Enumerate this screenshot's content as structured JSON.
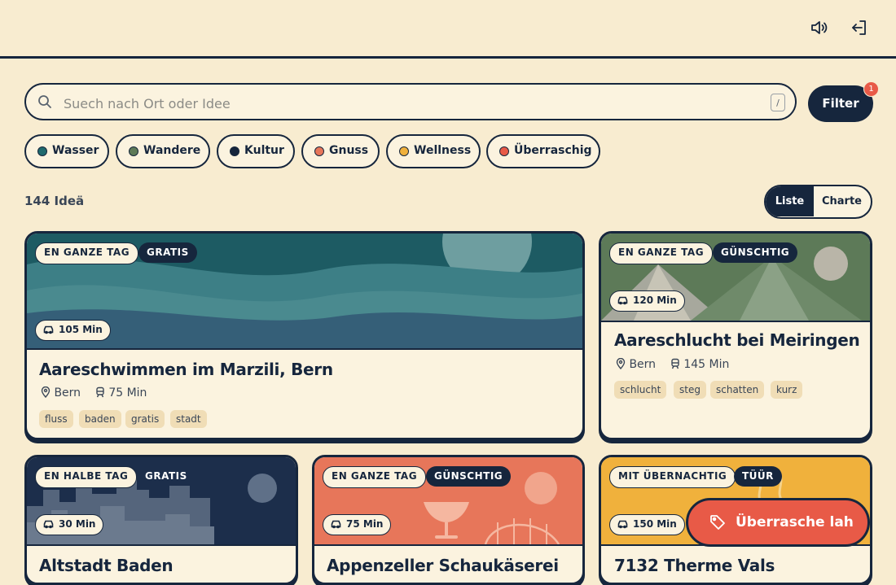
{
  "header": {
    "sound_icon": "speaker-icon",
    "logout_icon": "logout-icon"
  },
  "search": {
    "placeholder": "Suech nach Ort oder Idee",
    "shortcut": "/"
  },
  "filter": {
    "label": "Filter",
    "badge": "1"
  },
  "chips": [
    {
      "label": "Wasser",
      "color": "#1f6a6e"
    },
    {
      "label": "Wandere",
      "color": "#5d7a58"
    },
    {
      "label": "Kultur",
      "color": "#16263d"
    },
    {
      "label": "Gnuss",
      "color": "#e7765a"
    },
    {
      "label": "Wellness",
      "color": "#f0b13c"
    },
    {
      "label": "Überraschig",
      "color": "#e85a47"
    }
  ],
  "results": {
    "count": "144 Ideä"
  },
  "view_toggle": {
    "list": "Liste",
    "map": "Charte",
    "active": "Liste"
  },
  "cards": [
    {
      "duration": "EN GANZE TAG",
      "price": "GRATIS",
      "travel": "105 Min",
      "title": "Aareschwimmen im Marzili, Bern",
      "location": "Bern",
      "train": "75 Min",
      "tags": [
        "fluss",
        "baden",
        "gratis",
        "stadt"
      ]
    },
    {
      "duration": "EN GANZE TAG",
      "price": "GÜNSCHTIG",
      "travel": "120 Min",
      "title": "Aareschlucht bei Meiringen",
      "location": "Bern",
      "train": "145 Min",
      "tags": [
        "schlucht",
        "steg",
        "schatten",
        "kurz"
      ]
    },
    {
      "duration": "EN HALBE TAG",
      "price": "GRATIS",
      "travel": "30 Min",
      "title": "Altstadt Baden"
    },
    {
      "duration": "EN GANZE TAG",
      "price": "GÜNSCHTIG",
      "travel": "75 Min",
      "title": "Appenzeller Schaukäserei"
    },
    {
      "duration": "MIT ÜBERNACHTIG",
      "price": "TÜÜR",
      "travel": "150 Min",
      "title": "7132 Therme Vals"
    }
  ],
  "surprise_button": {
    "label": "Überrasche lah"
  }
}
